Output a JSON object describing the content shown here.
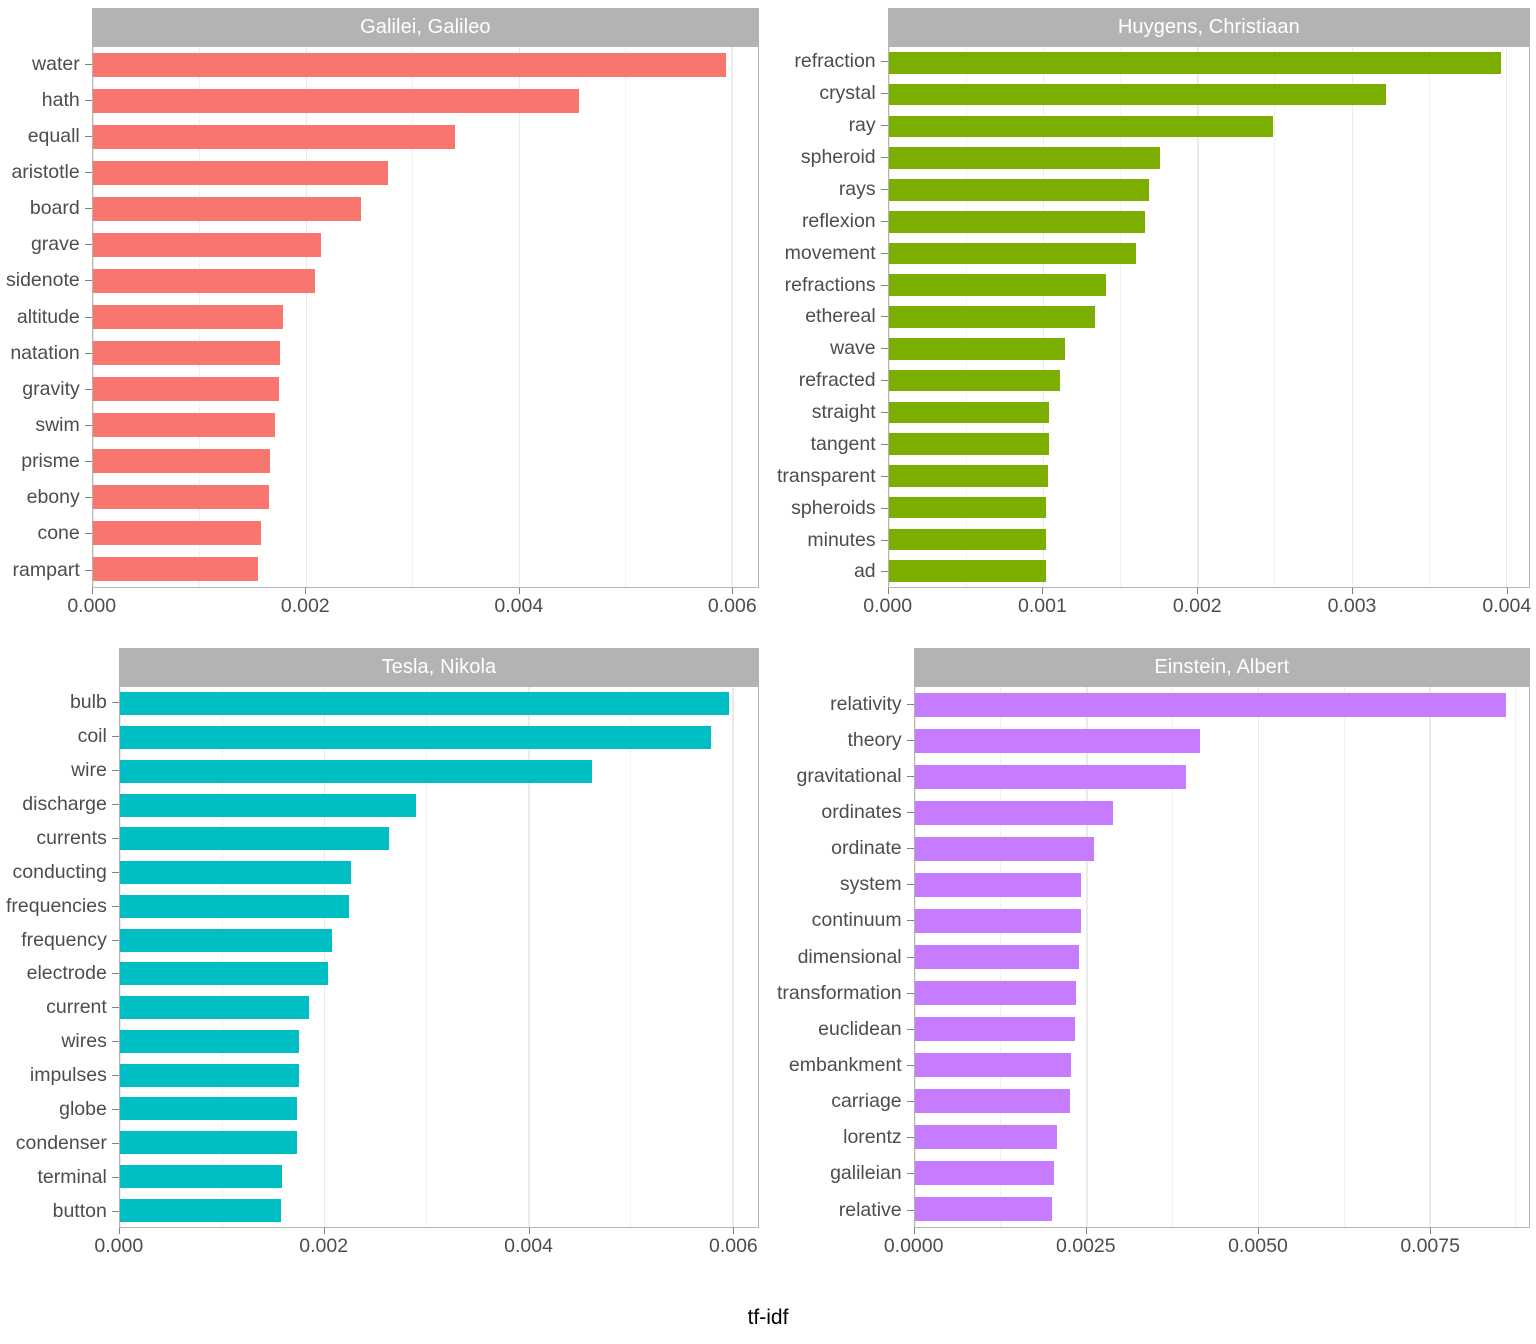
{
  "figure": {
    "xlabel": "tf-idf"
  },
  "chart_data": {
    "type": "bar",
    "title": "",
    "xlabel": "tf-idf",
    "ylabel": "",
    "orientation": "horizontal",
    "grid": true,
    "legend": false,
    "facet_layout": "2x2",
    "panels": [
      {
        "title": "Galilei, Galileo",
        "color": "#F8766D",
        "xlim": [
          0,
          0.00625
        ],
        "xticks": [
          0,
          0.002,
          0.004,
          0.006
        ],
        "xticklabels": [
          "0.000",
          "0.002",
          "0.004",
          "0.006"
        ],
        "minor_xticks": [
          0.001,
          0.003,
          0.005
        ],
        "categories": [
          "water",
          "hath",
          "equall",
          "aristotle",
          "board",
          "grave",
          "sidenote",
          "altitude",
          "natation",
          "gravity",
          "swim",
          "prisme",
          "ebony",
          "cone",
          "rampart"
        ],
        "values": [
          0.00595,
          0.00457,
          0.0034,
          0.00277,
          0.00252,
          0.00214,
          0.00209,
          0.00179,
          0.00176,
          0.00175,
          0.00171,
          0.00167,
          0.00166,
          0.00158,
          0.00155
        ]
      },
      {
        "title": "Huygens, Christiaan",
        "color": "#7CAE00",
        "xlim": [
          0,
          0.00415
        ],
        "xticks": [
          0,
          0.001,
          0.002,
          0.003,
          0.004
        ],
        "xticklabels": [
          "0.000",
          "0.001",
          "0.002",
          "0.003",
          "0.004"
        ],
        "minor_xticks": [
          0.0005,
          0.0015,
          0.0025,
          0.0035
        ],
        "categories": [
          "refraction",
          "crystal",
          "ray",
          "spheroid",
          "rays",
          "reflexion",
          "movement",
          "refractions",
          "ethereal",
          "wave",
          "refracted",
          "straight",
          "tangent",
          "transparent",
          "spheroids",
          "minutes",
          "ad"
        ],
        "values": [
          0.00397,
          0.00322,
          0.00249,
          0.00176,
          0.00169,
          0.00166,
          0.0016,
          0.00141,
          0.00134,
          0.00114,
          0.00111,
          0.00104,
          0.00104,
          0.00103,
          0.00102,
          0.00102,
          0.00102
        ]
      },
      {
        "title": "Tesla, Nikola",
        "color": "#00BFC4",
        "xlim": [
          0,
          0.00625
        ],
        "xticks": [
          0,
          0.002,
          0.004,
          0.006
        ],
        "xticklabels": [
          "0.000",
          "0.002",
          "0.004",
          "0.006"
        ],
        "minor_xticks": [
          0.001,
          0.003,
          0.005
        ],
        "categories": [
          "bulb",
          "coil",
          "wire",
          "discharge",
          "currents",
          "conducting",
          "frequencies",
          "frequency",
          "electrode",
          "current",
          "wires",
          "impulses",
          "globe",
          "condenser",
          "terminal",
          "button"
        ],
        "values": [
          0.00597,
          0.00579,
          0.00462,
          0.0029,
          0.00264,
          0.00226,
          0.00224,
          0.00208,
          0.00204,
          0.00185,
          0.00175,
          0.00175,
          0.00174,
          0.00174,
          0.00159,
          0.00158
        ]
      },
      {
        "title": "Einstein, Albert",
        "color": "#C77CFF",
        "xlim": [
          0,
          0.00895
        ],
        "xticks": [
          0,
          0.0025,
          0.005,
          0.0075
        ],
        "xticklabels": [
          "0.0000",
          "0.0025",
          "0.0050",
          "0.0075"
        ],
        "minor_xticks": [
          0.00125,
          0.00375,
          0.00625,
          0.00875
        ],
        "categories": [
          "relativity",
          "theory",
          "gravitational",
          "ordinates",
          "ordinate",
          "system",
          "continuum",
          "dimensional",
          "transformation",
          "euclidean",
          "embankment",
          "carriage",
          "lorentz",
          "galileian",
          "relative"
        ],
        "values": [
          0.00862,
          0.00415,
          0.00396,
          0.00289,
          0.00262,
          0.00243,
          0.00242,
          0.0024,
          0.00235,
          0.00234,
          0.00228,
          0.00226,
          0.00207,
          0.00203,
          0.002
        ]
      }
    ]
  }
}
